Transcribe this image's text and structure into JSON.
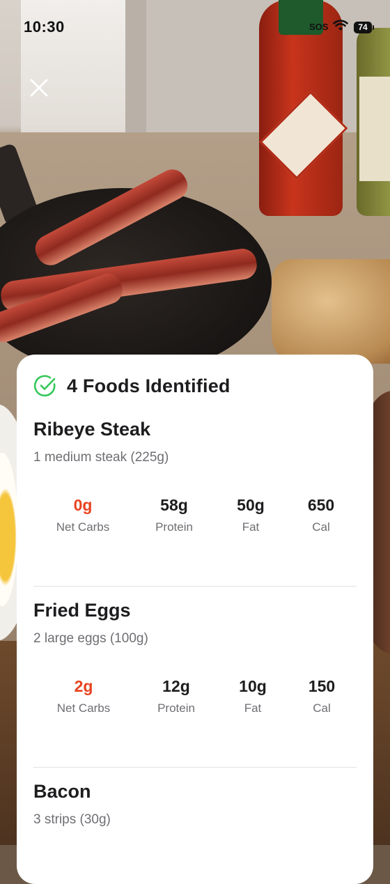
{
  "status_bar": {
    "time": "10:30",
    "sos": "SOS",
    "battery": "74"
  },
  "card": {
    "title": "4 Foods Identified",
    "accent_color": "#e8431f",
    "check_color": "#34c759",
    "foods": [
      {
        "name": "Ribeye Steak",
        "portion": "1 medium steak (225g)",
        "macros": [
          {
            "value": "0g",
            "label": "Net Carbs"
          },
          {
            "value": "58g",
            "label": "Protein"
          },
          {
            "value": "50g",
            "label": "Fat"
          },
          {
            "value": "650",
            "label": "Cal"
          }
        ]
      },
      {
        "name": "Fried Eggs",
        "portion": "2 large eggs (100g)",
        "macros": [
          {
            "value": "2g",
            "label": "Net Carbs"
          },
          {
            "value": "12g",
            "label": "Protein"
          },
          {
            "value": "10g",
            "label": "Fat"
          },
          {
            "value": "150",
            "label": "Cal"
          }
        ]
      },
      {
        "name": "Bacon",
        "portion": "3 strips (30g)"
      }
    ]
  }
}
